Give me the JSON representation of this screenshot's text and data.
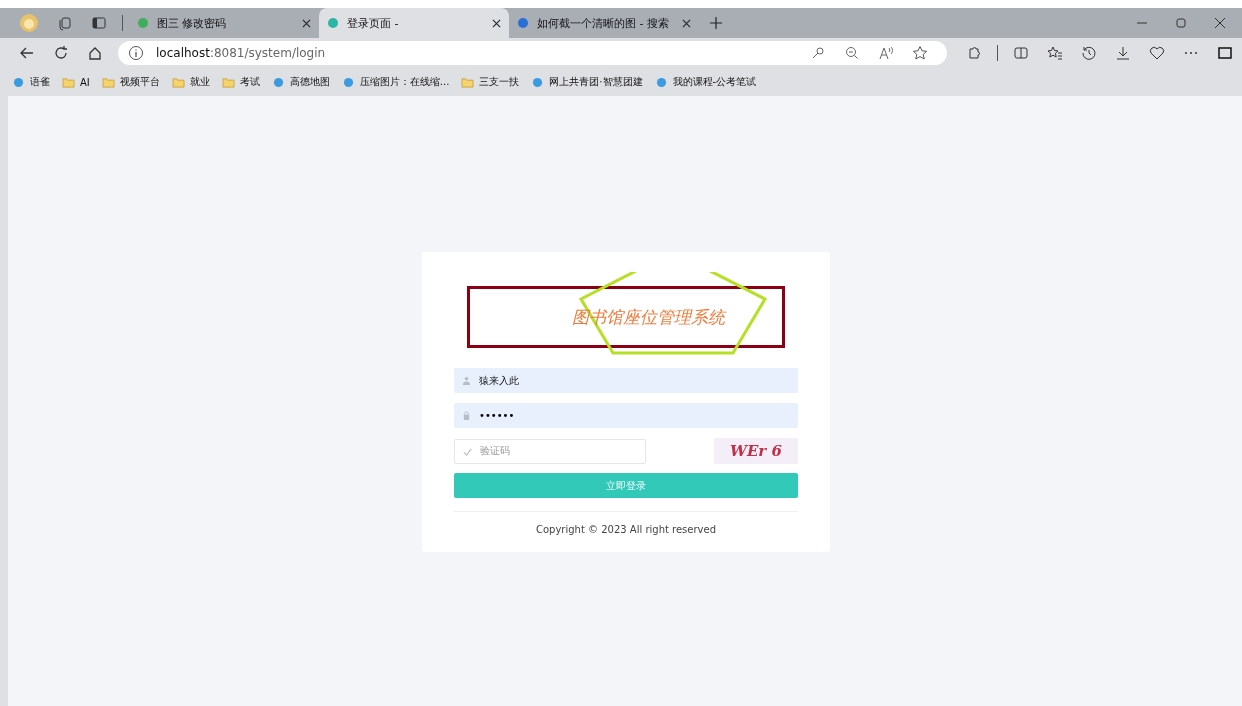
{
  "tabs": [
    {
      "title": "图三 修改密码",
      "selected": false
    },
    {
      "title": "登录页面 -",
      "selected": true
    },
    {
      "title": "如何截一个清晰的图 - 搜索",
      "selected": false
    }
  ],
  "address": {
    "host": "localhost",
    "rest": ":8081/system/login"
  },
  "bookmarks": [
    {
      "label": "语雀",
      "kind": "site"
    },
    {
      "label": "AI",
      "kind": "folder"
    },
    {
      "label": "视频平台",
      "kind": "folder"
    },
    {
      "label": "就业",
      "kind": "folder"
    },
    {
      "label": "考试",
      "kind": "folder"
    },
    {
      "label": "高德地图",
      "kind": "site"
    },
    {
      "label": "压缩图片：在线缩...",
      "kind": "site"
    },
    {
      "label": "三支一扶",
      "kind": "folder"
    },
    {
      "label": "网上共青团·智慧团建",
      "kind": "site"
    },
    {
      "label": "我的课程-公考笔试",
      "kind": "site"
    }
  ],
  "login": {
    "title": "图书馆座位管理系统",
    "username": "猿来入此",
    "password": "••••••",
    "captcha_placeholder": "验证码",
    "captcha_image": "WEr 6",
    "submit": "立即登录",
    "footer": "Copyright © 2023 All right reserved"
  }
}
